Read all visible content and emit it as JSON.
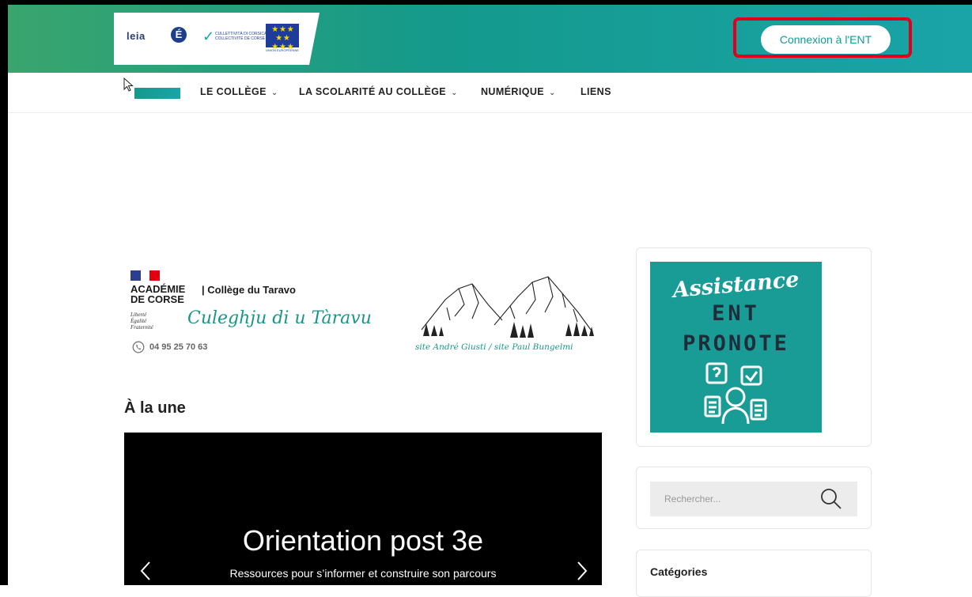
{
  "header": {
    "logos": {
      "leia": "leia",
      "academie": "académie Corse",
      "collectivite_line1": "CULLETTIVITÀ DI CORSICA",
      "collectivite_line2": "COLLECTIVITÉ DE CORSE",
      "eu": "UNION EUROPÉENNE"
    },
    "ent_button_label": "Connexion à l'ENT",
    "highlight_color": "#e0001b",
    "accent_color": "#1aa4a8"
  },
  "nav": {
    "items": [
      {
        "label": "LE COLLÈGE",
        "dropdown": true
      },
      {
        "label": "LA SCOLARITÉ AU COLLÈGE",
        "dropdown": true
      },
      {
        "label": "NUMÉRIQUE",
        "dropdown": true
      },
      {
        "label": "LIENS",
        "dropdown": false
      }
    ],
    "chevron": "⌄"
  },
  "banner": {
    "academie": "ACADÉMIE DE CORSE",
    "devise": "Liberté Égalité Fraternité",
    "college": "|  Collège du Taravo",
    "college_corse": "Culeghju di u Tàravu",
    "phone": "04 95 25 70 63",
    "sites": "site André Giusti / site Paul Bungelmi"
  },
  "main": {
    "section_title": "À la une",
    "slide": {
      "title": "Orientation post 3e",
      "subtitle": "Ressources pour s’informer et construire son parcours"
    }
  },
  "sidebar": {
    "assistance": {
      "line1": "Assistance",
      "line2": "ENT",
      "line3": "PRONOTE"
    },
    "search": {
      "placeholder": "Rechercher..."
    },
    "categories_title": "Catégories"
  }
}
